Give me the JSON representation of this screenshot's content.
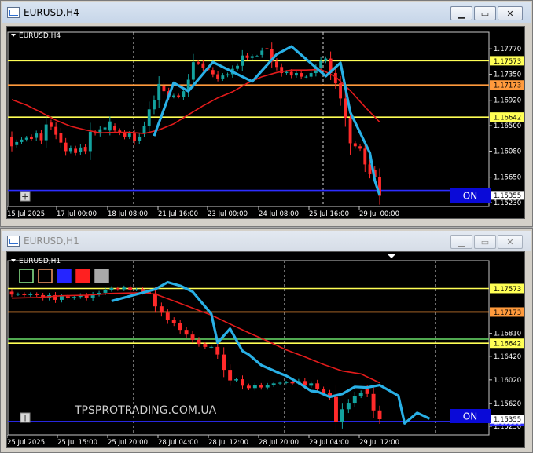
{
  "windows": [
    {
      "title": "EURUSD,H4",
      "symbol_label": "EURUSD,H4",
      "on_label": "ON",
      "price_ticks": [
        "1.17770",
        "1.17350",
        "1.16920",
        "1.16500",
        "1.16080",
        "1.15650",
        "1.15230"
      ],
      "levels": [
        {
          "label": "1.17573",
          "value": 1.17573,
          "color": "#ffff55"
        },
        {
          "label": "1.17173",
          "value": 1.17173,
          "color": "#ff9a3c"
        },
        {
          "label": "1.16642",
          "value": 1.16642,
          "color": "#ffff55"
        },
        {
          "label": "",
          "value": 1.1543,
          "color": "#2d2dff"
        }
      ],
      "current_price_label": "1.15355",
      "time_ticks": [
        "15 Jul 2025",
        "17 Jul 00:00",
        "18 Jul 08:00",
        "21 Jul 16:00",
        "23 Jul 00:00",
        "24 Jul 08:00",
        "25 Jul 16:00",
        "29 Jul 00:00"
      ],
      "chart_data": {
        "type": "candlestick",
        "ylim": [
          1.1523,
          1.1798
        ],
        "ma_color": "#e21b1b",
        "zigzag_color": "#29b0e6",
        "up_color": "#13a39f",
        "down_color": "#ff2a2a",
        "candles": [
          [
            1.1632,
            1.1616
          ],
          [
            1.1618,
            1.1623
          ],
          [
            1.1623,
            1.1627
          ],
          [
            1.1627,
            1.163
          ],
          [
            1.1632,
            1.1628
          ],
          [
            1.163,
            1.1637
          ],
          [
            1.1637,
            1.1626
          ],
          [
            1.1626,
            1.1652
          ],
          [
            1.1655,
            1.1648
          ],
          [
            1.1648,
            1.1635
          ],
          [
            1.1638,
            1.1622
          ],
          [
            1.1622,
            1.1608
          ],
          [
            1.1608,
            1.1613
          ],
          [
            1.1612,
            1.1605
          ],
          [
            1.1606,
            1.1614
          ],
          [
            1.1615,
            1.1608
          ],
          [
            1.1608,
            1.164
          ],
          [
            1.164,
            1.1637
          ],
          [
            1.1637,
            1.1644
          ],
          [
            1.1644,
            1.1647
          ],
          [
            1.1642,
            1.1657
          ],
          [
            1.1649,
            1.1642
          ],
          [
            1.1642,
            1.1638
          ],
          [
            1.1638,
            1.1632
          ],
          [
            1.1632,
            1.1637
          ],
          [
            1.1637,
            1.1625
          ],
          [
            1.1625,
            1.1632
          ],
          [
            1.1638,
            1.165
          ],
          [
            1.165,
            1.1677
          ],
          [
            1.1677,
            1.1692
          ],
          [
            1.1692,
            1.1719
          ],
          [
            1.1716,
            1.1707
          ],
          [
            1.1707,
            1.1698
          ],
          [
            1.1698,
            1.17
          ],
          [
            1.17,
            1.1698
          ],
          [
            1.1698,
            1.1707
          ],
          [
            1.1707,
            1.1726
          ],
          [
            1.1726,
            1.1755
          ],
          [
            1.1755,
            1.1753
          ],
          [
            1.1753,
            1.1745
          ],
          [
            1.1745,
            1.1742
          ],
          [
            1.1742,
            1.1735
          ],
          [
            1.1735,
            1.1728
          ],
          [
            1.1728,
            1.1733
          ],
          [
            1.1733,
            1.1735
          ],
          [
            1.1735,
            1.1744
          ],
          [
            1.1744,
            1.1749
          ],
          [
            1.1749,
            1.1766
          ],
          [
            1.1766,
            1.1762
          ],
          [
            1.1762,
            1.1765
          ],
          [
            1.1765,
            1.1765
          ],
          [
            1.1767,
            1.1774
          ],
          [
            1.1778,
            1.1777
          ],
          [
            1.1777,
            1.1756
          ],
          [
            1.1756,
            1.1747
          ],
          [
            1.1747,
            1.1737
          ],
          [
            1.1737,
            1.1739
          ],
          [
            1.1739,
            1.1733
          ],
          [
            1.1733,
            1.1737
          ],
          [
            1.1737,
            1.1731
          ],
          [
            1.1731,
            1.1731
          ],
          [
            1.1731,
            1.1737
          ],
          [
            1.1737,
            1.1746
          ],
          [
            1.1746,
            1.1757
          ],
          [
            1.1757,
            1.1761
          ],
          [
            1.1761,
            1.1737
          ],
          [
            1.1737,
            1.172
          ],
          [
            1.172,
            1.1695
          ],
          [
            1.1695,
            1.1663
          ],
          [
            1.1663,
            1.1621
          ],
          [
            1.1621,
            1.1616
          ],
          [
            1.1616,
            1.1612
          ],
          [
            1.1612,
            1.1586
          ],
          [
            1.1586,
            1.1571
          ],
          [
            1.1577,
            1.1565
          ],
          [
            1.1565,
            1.1534
          ]
        ],
        "ma": [
          [
            0,
            1.1693
          ],
          [
            3,
            1.1684
          ],
          [
            6,
            1.1672
          ],
          [
            9,
            1.1659
          ],
          [
            12,
            1.1649
          ],
          [
            15,
            1.1643
          ],
          [
            18,
            1.1638
          ],
          [
            21,
            1.1639
          ],
          [
            24,
            1.1639
          ],
          [
            27,
            1.1637
          ],
          [
            30,
            1.1643
          ],
          [
            33,
            1.1653
          ],
          [
            36,
            1.1668
          ],
          [
            39,
            1.1683
          ],
          [
            42,
            1.1696
          ],
          [
            45,
            1.1706
          ],
          [
            48,
            1.172
          ],
          [
            51,
            1.1731
          ],
          [
            54,
            1.1738
          ],
          [
            57,
            1.1742
          ],
          [
            60,
            1.1742
          ],
          [
            63,
            1.1743
          ],
          [
            66,
            1.1731
          ],
          [
            69,
            1.1708
          ],
          [
            72,
            1.1681
          ],
          [
            75,
            1.1656
          ]
        ],
        "zigzag": [
          [
            29,
            1.1633
          ],
          [
            33,
            1.1721
          ],
          [
            36,
            1.1707
          ],
          [
            41,
            1.1755
          ],
          [
            49,
            1.1723
          ],
          [
            54,
            1.1768
          ],
          [
            57,
            1.1781
          ],
          [
            64,
            1.1732
          ],
          [
            67,
            1.1754
          ],
          [
            69,
            1.1672
          ],
          [
            73,
            1.1605
          ],
          [
            74,
            1.1559
          ],
          [
            75,
            1.1535
          ]
        ]
      }
    },
    {
      "title": "EURUSD,H1",
      "symbol_label": "EURUSD,H1",
      "on_label": "ON",
      "watermark": "TPSPROTRADING.COM.UA",
      "price_ticks": [
        "1.16810",
        "1.16420",
        "1.16020",
        "1.15620",
        "1.15230"
      ],
      "levels": [
        {
          "label": "1.17573",
          "value": 1.17573,
          "color": "#ffff55"
        },
        {
          "label": "1.17173",
          "value": 1.17173,
          "color": "#ff9a3c"
        },
        {
          "label": "1.16642",
          "value": 1.16642,
          "color": "#ffff55"
        },
        {
          "label": "",
          "value": 1.16712,
          "color": "#6be06b"
        },
        {
          "label": "1.15311",
          "value": 1.15311,
          "color": "#2d2dff"
        }
      ],
      "current_price_label": "1.15355",
      "time_ticks": [
        "25 Jul 2025",
        "25 Jul 15:00",
        "25 Jul 20:00",
        "28 Jul 04:00",
        "28 Jul 12:00",
        "28 Jul 20:00",
        "29 Jul 04:00",
        "29 Jul 12:00"
      ],
      "swatch_colors": [
        "#90ee90",
        "#f59a68",
        "#2525ff",
        "#ff2020",
        "#a9a9a9"
      ],
      "chart_data": {
        "type": "candlestick",
        "ylim": [
          1.1515,
          1.1798
        ],
        "ma_color": "#e21b1b",
        "zigzag_color": "#29b0e6",
        "up_color": "#13a39f",
        "down_color": "#ff2a2a",
        "candles": [
          [
            1.1752,
            1.1747
          ],
          [
            1.1747,
            1.1748
          ],
          [
            1.1748,
            1.1746
          ],
          [
            1.1746,
            1.1748
          ],
          [
            1.1748,
            1.1746
          ],
          [
            1.1746,
            1.1741
          ],
          [
            1.1741,
            1.1746
          ],
          [
            1.1746,
            1.1738
          ],
          [
            1.1738,
            1.1744
          ],
          [
            1.1744,
            1.1741
          ],
          [
            1.1741,
            1.1743
          ],
          [
            1.1743,
            1.1746
          ],
          [
            1.1746,
            1.1741
          ],
          [
            1.1741,
            1.1747
          ],
          [
            1.1747,
            1.175
          ],
          [
            1.175,
            1.1755
          ],
          [
            1.1755,
            1.1758
          ],
          [
            1.1758,
            1.1756
          ],
          [
            1.1756,
            1.1759
          ],
          [
            1.1759,
            1.1755
          ],
          [
            1.1755,
            1.1756
          ],
          [
            1.1756,
            1.1751
          ],
          [
            1.1751,
            1.1749
          ],
          [
            1.1749,
            1.1727
          ],
          [
            1.1727,
            1.1716
          ],
          [
            1.1716,
            1.1704
          ],
          [
            1.1704,
            1.1698
          ],
          [
            1.1698,
            1.1687
          ],
          [
            1.1687,
            1.1679
          ],
          [
            1.1679,
            1.167
          ],
          [
            1.167,
            1.1663
          ],
          [
            1.1663,
            1.1658
          ],
          [
            1.1658,
            1.1658
          ],
          [
            1.1658,
            1.1645
          ],
          [
            1.1645,
            1.1619
          ],
          [
            1.1619,
            1.1601
          ],
          [
            1.1601,
            1.1603
          ],
          [
            1.1603,
            1.1592
          ],
          [
            1.1592,
            1.1588
          ],
          [
            1.1588,
            1.1593
          ],
          [
            1.1593,
            1.1589
          ],
          [
            1.1589,
            1.1593
          ],
          [
            1.1593,
            1.1596
          ],
          [
            1.1596,
            1.1597
          ],
          [
            1.1597,
            1.1598
          ],
          [
            1.1598,
            1.1596
          ],
          [
            1.1596,
            1.16
          ],
          [
            1.16,
            1.1592
          ],
          [
            1.1592,
            1.1596
          ],
          [
            1.1596,
            1.1586
          ],
          [
            1.1586,
            1.158
          ],
          [
            1.158,
            1.1573
          ],
          [
            1.1573,
            1.153
          ],
          [
            1.153,
            1.1552
          ],
          [
            1.1552,
            1.1563
          ],
          [
            1.1563,
            1.1575
          ],
          [
            1.1575,
            1.158
          ],
          [
            1.1587,
            1.1578
          ],
          [
            1.1578,
            1.155
          ],
          [
            1.155,
            1.1535
          ]
        ],
        "ma": [
          [
            0,
            1.1741
          ],
          [
            4,
            1.1742
          ],
          [
            8,
            1.1745
          ],
          [
            12,
            1.1746
          ],
          [
            16,
            1.1749
          ],
          [
            20,
            1.175
          ],
          [
            23,
            1.1748
          ],
          [
            26,
            1.1736
          ],
          [
            29,
            1.1724
          ],
          [
            32,
            1.1712
          ],
          [
            35,
            1.1697
          ],
          [
            38,
            1.1682
          ],
          [
            41,
            1.1668
          ],
          [
            44,
            1.1653
          ],
          [
            47,
            1.1641
          ],
          [
            50,
            1.1628
          ],
          [
            53,
            1.1617
          ],
          [
            56,
            1.1612
          ],
          [
            59,
            1.1597
          ]
        ],
        "zigzag": [
          [
            16,
            1.1736
          ],
          [
            23,
            1.1756
          ],
          [
            25,
            1.1768
          ],
          [
            27,
            1.1762
          ],
          [
            29,
            1.1752
          ],
          [
            32,
            1.1714
          ],
          [
            33,
            1.1665
          ],
          [
            35,
            1.1689
          ],
          [
            37,
            1.1651
          ],
          [
            38,
            1.1645
          ],
          [
            40,
            1.1627
          ],
          [
            43,
            1.1613
          ],
          [
            44,
            1.1609
          ],
          [
            46,
            1.1597
          ],
          [
            48,
            1.1583
          ],
          [
            49,
            1.1582
          ],
          [
            51,
            1.1573
          ],
          [
            53,
            1.1578
          ],
          [
            55,
            1.159
          ],
          [
            57,
            1.1589
          ],
          [
            59,
            1.1593
          ],
          [
            61,
            1.1581
          ],
          [
            62,
            1.1575
          ],
          [
            63,
            1.1528
          ],
          [
            65,
            1.1546
          ],
          [
            67,
            1.1536
          ]
        ]
      }
    }
  ]
}
